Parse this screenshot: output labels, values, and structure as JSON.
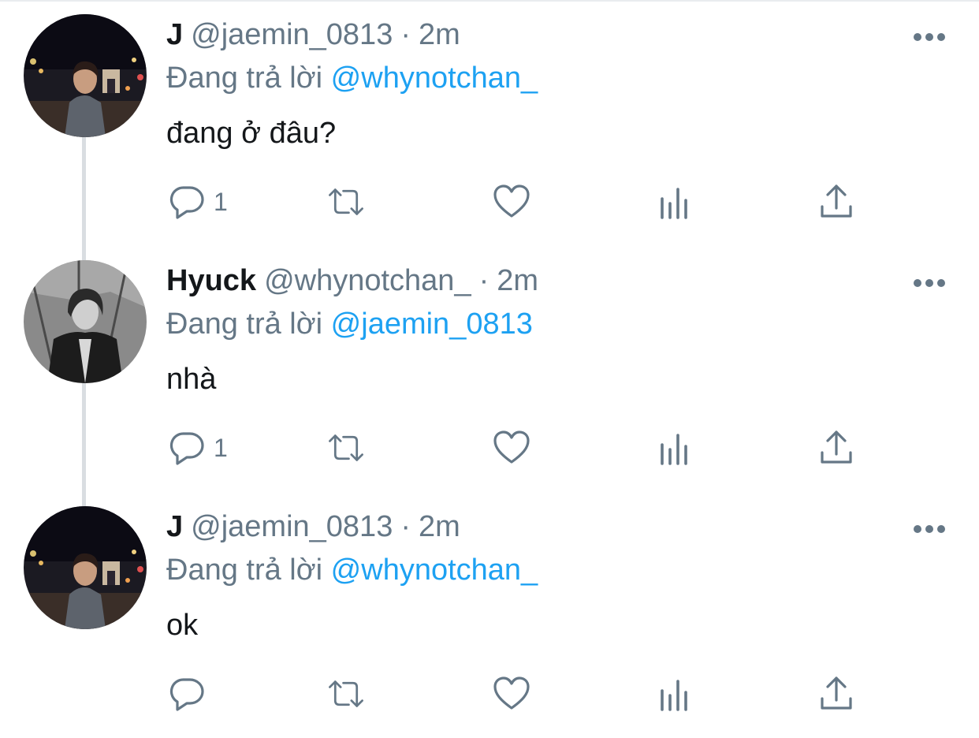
{
  "tweets": [
    {
      "display_name": "J",
      "handle": "@jaemin_0813",
      "separator": "·",
      "time": "2m",
      "replying_prefix": "Đang trả lời",
      "replying_to": "@whynotchan_",
      "text": "đang ở đâu?",
      "reply_count": "1",
      "avatar": "night-city-portrait"
    },
    {
      "display_name": "Hyuck",
      "handle": "@whynotchan_",
      "separator": "·",
      "time": "2m",
      "replying_prefix": "Đang trả lời",
      "replying_to": "@jaemin_0813",
      "text": "nhà",
      "reply_count": "1",
      "avatar": "monochrome-portrait"
    },
    {
      "display_name": "J",
      "handle": "@jaemin_0813",
      "separator": "·",
      "time": "2m",
      "replying_prefix": "Đang trả lời",
      "replying_to": "@whynotchan_",
      "text": "ok",
      "reply_count": "",
      "avatar": "night-city-portrait"
    }
  ],
  "icons": {
    "reply": "reply-icon",
    "retweet": "retweet-icon",
    "like": "heart-icon",
    "stats": "analytics-icon",
    "share": "share-icon",
    "more": "more-icon"
  },
  "colors": {
    "text": "#14171a",
    "muted": "#657786",
    "mention": "#1da1f2",
    "thread_line": "#d9dde1"
  }
}
